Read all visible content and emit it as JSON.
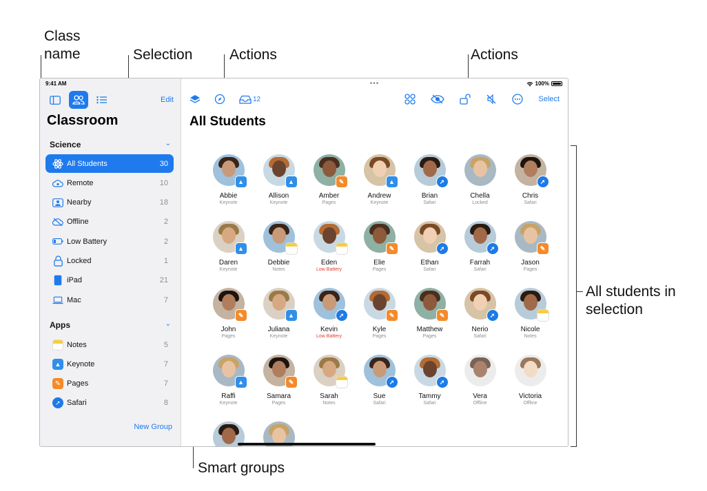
{
  "callouts": {
    "class_name_line1": "Class",
    "class_name_line2": "name",
    "selection": "Selection",
    "actions_left": "Actions",
    "actions_right": "Actions",
    "smart_groups": "Smart groups",
    "all_students_line1": "All students in",
    "all_students_line2": "selection"
  },
  "status_bar": {
    "time": "9:41 AM",
    "battery": "100%"
  },
  "sidebar": {
    "edit_label": "Edit",
    "title": "Classroom",
    "class_section": "Science",
    "groups": [
      {
        "label": "All Students",
        "count": "30",
        "icon": "atom-icon",
        "selected": true
      },
      {
        "label": "Remote",
        "count": "10",
        "icon": "cloud-remote-icon"
      },
      {
        "label": "Nearby",
        "count": "18",
        "icon": "nearby-person-icon"
      },
      {
        "label": "Offline",
        "count": "2",
        "icon": "cloud-offline-icon"
      },
      {
        "label": "Low Battery",
        "count": "2",
        "icon": "battery-low-icon"
      },
      {
        "label": "Locked",
        "count": "1",
        "icon": "lock-icon"
      },
      {
        "label": "iPad",
        "count": "21",
        "icon": "ipad-icon"
      },
      {
        "label": "Mac",
        "count": "7",
        "icon": "laptop-icon"
      }
    ],
    "apps_section": "Apps",
    "apps": [
      {
        "label": "Notes",
        "count": "5",
        "icon": "notes-app-icon"
      },
      {
        "label": "Keynote",
        "count": "7",
        "icon": "keynote-app-icon"
      },
      {
        "label": "Pages",
        "count": "7",
        "icon": "pages-app-icon"
      },
      {
        "label": "Safari",
        "count": "8",
        "icon": "safari-app-icon"
      }
    ],
    "new_group_label": "New Group"
  },
  "main": {
    "badge_count": "12",
    "select_label": "Select",
    "title": "All Students",
    "students": [
      {
        "name": "Abbie",
        "status": "Keynote",
        "app": "keynote"
      },
      {
        "name": "Allison",
        "status": "Keynote",
        "app": "keynote"
      },
      {
        "name": "Amber",
        "status": "Pages",
        "app": "pages"
      },
      {
        "name": "Andrew",
        "status": "Keynote",
        "app": "keynote"
      },
      {
        "name": "Brian",
        "status": "Safari",
        "app": "safari"
      },
      {
        "name": "Chella",
        "status": "Locked",
        "app": ""
      },
      {
        "name": "Chris",
        "status": "Safari",
        "app": "safari"
      },
      {
        "name": "Daren",
        "status": "Keynote",
        "app": "keynote"
      },
      {
        "name": "Debbie",
        "status": "Notes",
        "app": "notes"
      },
      {
        "name": "Eden",
        "status": "Low Battery",
        "app": "notes",
        "warn": true
      },
      {
        "name": "Elie",
        "status": "Pages",
        "app": "pages"
      },
      {
        "name": "Ethan",
        "status": "Safari",
        "app": "safari"
      },
      {
        "name": "Farrah",
        "status": "Safari",
        "app": "safari"
      },
      {
        "name": "Jason",
        "status": "Pages",
        "app": "pages"
      },
      {
        "name": "John",
        "status": "Pages",
        "app": "pages"
      },
      {
        "name": "Juliana",
        "status": "Keynote",
        "app": "keynote"
      },
      {
        "name": "Kevin",
        "status": "Low Battery",
        "app": "safari",
        "warn": true
      },
      {
        "name": "Kyle",
        "status": "Pages",
        "app": "pages"
      },
      {
        "name": "Matthew",
        "status": "Pages",
        "app": "pages"
      },
      {
        "name": "Nerio",
        "status": "Safari",
        "app": "safari"
      },
      {
        "name": "Nicole",
        "status": "Notes",
        "app": "notes"
      },
      {
        "name": "Raffi",
        "status": "Keynote",
        "app": "keynote"
      },
      {
        "name": "Samara",
        "status": "Pages",
        "app": "pages"
      },
      {
        "name": "Sarah",
        "status": "Notes",
        "app": "notes"
      },
      {
        "name": "Sue",
        "status": "Safari",
        "app": "safari"
      },
      {
        "name": "Tammy",
        "status": "Safari",
        "app": "safari"
      },
      {
        "name": "Vera",
        "status": "Offline",
        "app": ""
      },
      {
        "name": "Victoria",
        "status": "Offline",
        "app": ""
      },
      {
        "name": "",
        "status": "",
        "app": ""
      },
      {
        "name": "",
        "status": "",
        "app": ""
      }
    ]
  },
  "colors": {
    "accent": "#1f7aee",
    "keynote": "#2f8fe9",
    "pages": "#f48a2a",
    "safari": "#1d7ae6",
    "notes": "#f8cd3e",
    "warn": "#e03a2f"
  }
}
